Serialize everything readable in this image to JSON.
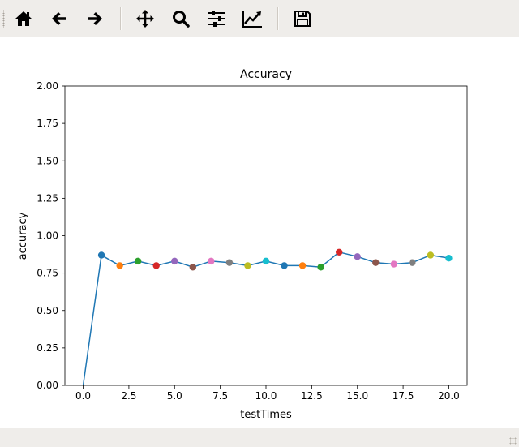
{
  "toolbar": {
    "buttons": [
      {
        "name": "home",
        "icon": "home-icon"
      },
      {
        "name": "back",
        "icon": "arrow-left-icon"
      },
      {
        "name": "forward",
        "icon": "arrow-right-icon"
      },
      {
        "name": "pan",
        "icon": "move-icon"
      },
      {
        "name": "zoom",
        "icon": "magnifier-icon"
      },
      {
        "name": "subplots",
        "icon": "sliders-icon"
      },
      {
        "name": "edit-axes",
        "icon": "line-chart-icon"
      },
      {
        "name": "save",
        "icon": "floppy-disk-icon"
      }
    ]
  },
  "chart_data": {
    "type": "line",
    "title": "Accuracy",
    "xlabel": "testTimes",
    "ylabel": "accuracy",
    "xlim": [
      -1,
      21
    ],
    "ylim": [
      0,
      2
    ],
    "x_ticks": [
      "0.0",
      "2.5",
      "5.0",
      "7.5",
      "10.0",
      "12.5",
      "15.0",
      "17.5",
      "20.0"
    ],
    "y_ticks": [
      "0.00",
      "0.25",
      "0.50",
      "0.75",
      "1.00",
      "1.25",
      "1.50",
      "1.75",
      "2.00"
    ],
    "grid": false,
    "line_color": "#1f77b4",
    "x": [
      0,
      1,
      2,
      3,
      4,
      5,
      6,
      7,
      8,
      9,
      10,
      11,
      12,
      13,
      14,
      15,
      16,
      17,
      18,
      19,
      20
    ],
    "y": [
      0.0,
      0.87,
      0.8,
      0.83,
      0.8,
      0.83,
      0.79,
      0.83,
      0.82,
      0.8,
      0.83,
      0.8,
      0.8,
      0.79,
      0.89,
      0.86,
      0.82,
      0.81,
      0.82,
      0.87,
      0.85
    ],
    "marker_colors": [
      "#1f77b4",
      "#ff7f0e",
      "#2ca02c",
      "#d62728",
      "#9467bd",
      "#8c564b",
      "#e377c2",
      "#7f7f7f",
      "#bcbd22",
      "#17becf"
    ]
  }
}
